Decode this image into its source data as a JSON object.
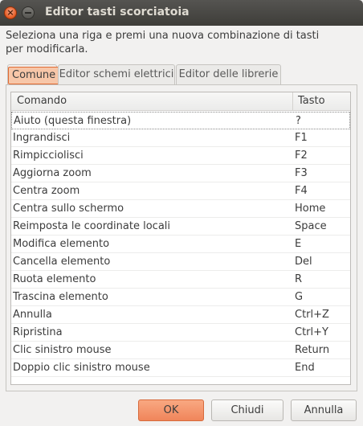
{
  "window": {
    "title": "Editor tasti scorciatoia"
  },
  "instructions": "Seleziona una riga e premi una nuova combinazione di tasti per modificarla.",
  "tabs": [
    {
      "label": "Comune",
      "active": true
    },
    {
      "label": "Editor schemi elettrici",
      "active": false
    },
    {
      "label": "Editor delle librerie",
      "active": false
    }
  ],
  "table": {
    "columns": [
      "Comando",
      "Tasto"
    ],
    "rows": [
      {
        "command": "Aiuto (questa finestra)",
        "key": "?"
      },
      {
        "command": "Ingrandisci",
        "key": "F1"
      },
      {
        "command": "Rimpicciolisci",
        "key": "F2"
      },
      {
        "command": "Aggiorna zoom",
        "key": "F3"
      },
      {
        "command": "Centra zoom",
        "key": "F4"
      },
      {
        "command": "Centra sullo schermo",
        "key": "Home"
      },
      {
        "command": "Reimposta le coordinate locali",
        "key": "Space"
      },
      {
        "command": "Modifica elemento",
        "key": "E"
      },
      {
        "command": "Cancella elemento",
        "key": "Del"
      },
      {
        "command": "Ruota elemento",
        "key": "R"
      },
      {
        "command": "Trascina elemento",
        "key": "G"
      },
      {
        "command": "Annulla",
        "key": "Ctrl+Z"
      },
      {
        "command": "Ripristina",
        "key": "Ctrl+Y"
      },
      {
        "command": "Clic sinistro mouse",
        "key": "Return"
      },
      {
        "command": "Doppio clic sinistro mouse",
        "key": "End"
      }
    ]
  },
  "buttons": {
    "ok": "OK",
    "close": "Chiudi",
    "cancel": "Annulla"
  },
  "colors": {
    "accent": "#f0855a",
    "titlebar": "#3e3d39",
    "close_button": "#e4581f"
  },
  "icons": {
    "close": "close-icon",
    "minimize": "minimize-icon"
  }
}
